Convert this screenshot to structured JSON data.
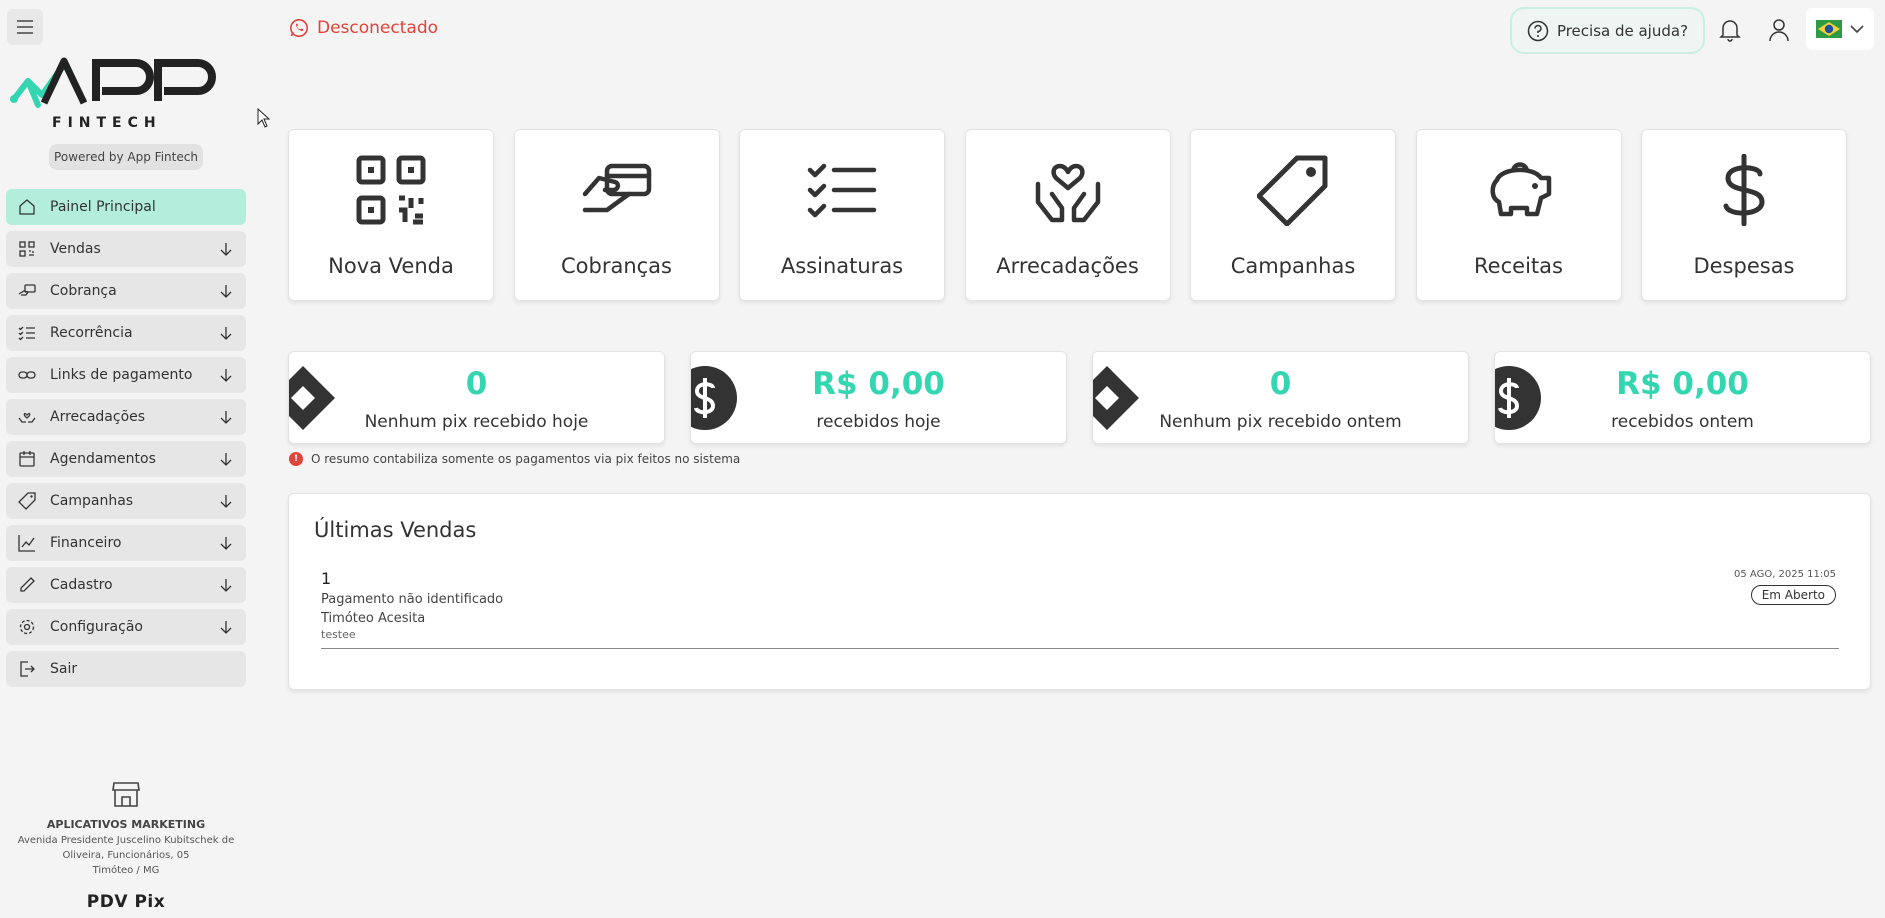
{
  "sidebar": {
    "powered_by": "Powered by App Fintech",
    "logo_text": "APP FINTECH",
    "items": [
      {
        "label": "Painel Principal",
        "icon": "home-icon",
        "active": true
      },
      {
        "label": "Vendas",
        "icon": "qrcode-icon"
      },
      {
        "label": "Cobrança",
        "icon": "hand-card-icon"
      },
      {
        "label": "Recorrência",
        "icon": "checklist-icon"
      },
      {
        "label": "Links de pagamento",
        "icon": "link-icon"
      },
      {
        "label": "Arrecadações",
        "icon": "donation-icon"
      },
      {
        "label": "Agendamentos",
        "icon": "calendar-icon"
      },
      {
        "label": "Campanhas",
        "icon": "tag-icon"
      },
      {
        "label": "Financeiro",
        "icon": "chart-line-icon"
      },
      {
        "label": "Cadastro",
        "icon": "pencil-icon"
      },
      {
        "label": "Configuração",
        "icon": "gear-icon"
      },
      {
        "label": "Sair",
        "icon": "logout-icon"
      }
    ],
    "company": {
      "name": "APLICATIVOS MARKETING",
      "address_line1": "Avenida Presidente Juscelino Kubitschek de",
      "address_line2": "Oliveira, Funcionários, 05",
      "address_line3": "Timóteo / MG",
      "product": "PDV Pix"
    }
  },
  "header": {
    "status": "Desconectado",
    "help": "Precisa de ajuda?",
    "language_flag": "brazil-flag-icon"
  },
  "tiles": [
    {
      "label": "Nova Venda",
      "icon": "qrcode-icon"
    },
    {
      "label": "Cobranças",
      "icon": "hand-card-icon"
    },
    {
      "label": "Assinaturas",
      "icon": "checklist-icon"
    },
    {
      "label": "Arrecadações",
      "icon": "donation-icon"
    },
    {
      "label": "Campanhas",
      "icon": "tag-icon"
    },
    {
      "label": "Receitas",
      "icon": "piggy-bank-icon"
    },
    {
      "label": "Despesas",
      "icon": "dollar-icon"
    }
  ],
  "stats": [
    {
      "value": "0",
      "label": "Nenhum pix recebido hoje",
      "icon": "pix-icon"
    },
    {
      "value": "R$ 0,00",
      "label": "recebidos hoje",
      "icon": "dollar-circle-icon"
    },
    {
      "value": "0",
      "label": "Nenhum pix recebido ontem",
      "icon": "pix-icon"
    },
    {
      "value": "R$ 0,00",
      "label": "recebidos ontem",
      "icon": "dollar-circle-icon"
    }
  ],
  "note": "O resumo contabiliza somente os pagamentos via pix feitos no sistema",
  "sales": {
    "title": "Últimas Vendas",
    "rows": [
      {
        "id": "1",
        "description": "Pagamento não identificado",
        "customer": "Timóteo Acesita",
        "note": "testee",
        "date": "05 AGO, 2025 11:05",
        "status": "Em Aberto"
      }
    ]
  },
  "colors": {
    "accent": "#33d6b0",
    "active_menu": "#b3eedd",
    "disconnected": "#e0443a"
  }
}
